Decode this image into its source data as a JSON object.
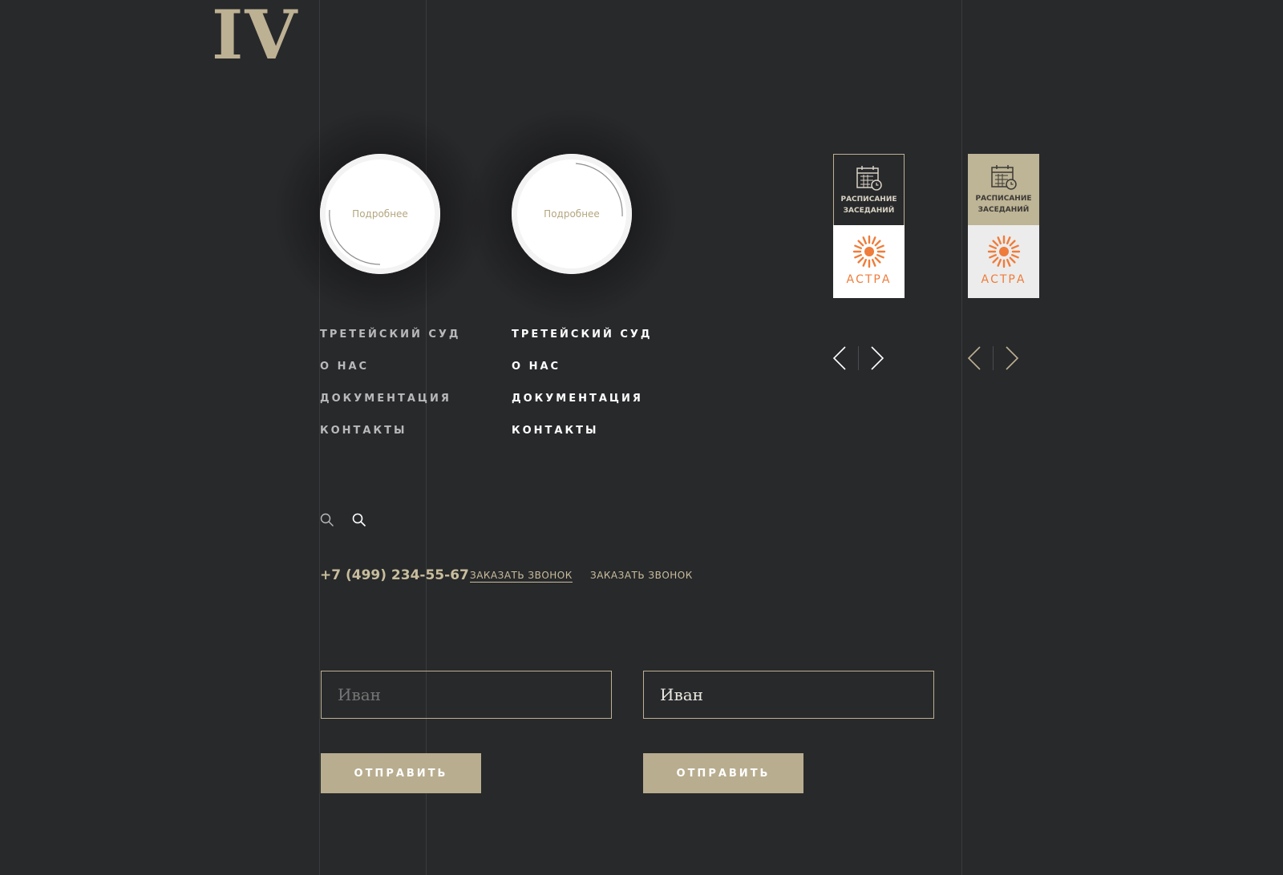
{
  "logo": {
    "text": "IV"
  },
  "circles": [
    {
      "label": "Подробнее"
    },
    {
      "label": "Подробнее"
    }
  ],
  "menu_dim": {
    "items": [
      "ТРЕТЕЙСКИЙ СУД",
      "О НАС",
      "ДОКУМЕНТАЦИЯ",
      "КОНТАКТЫ"
    ]
  },
  "menu_bright": {
    "items": [
      "ТРЕТЕЙСКИЙ СУД",
      "О НАС",
      "ДОКУМЕНТАЦИЯ",
      "КОНТАКТЫ"
    ]
  },
  "widgets": [
    {
      "line1": "РАСПИСАНИЕ",
      "line2": "ЗАСЕДАНИЙ",
      "brand": "АСТРА",
      "icon": "calendar-clock-icon",
      "logo_icon": "sun-logo-icon"
    },
    {
      "line1": "РАСПИСАНИЕ",
      "line2": "ЗАСЕДАНИЙ",
      "brand": "АСТРА",
      "icon": "calendar-clock-icon",
      "logo_icon": "sun-logo-icon"
    }
  ],
  "contact": {
    "phone": "+7 (499) 234-55-67",
    "callback_1": "ЗАКАЗАТЬ ЗВОНОК",
    "callback_2": "ЗАКАЗАТЬ ЗВОНОК"
  },
  "form": {
    "field_1_placeholder": "Иван",
    "field_2_value": "Иван",
    "submit_1": "ОТПРАВИТЬ",
    "submit_2": "ОТПРАВИТЬ"
  },
  "colors": {
    "background": "#28292b",
    "gold": "#bdb193",
    "button": "#b8ad8f",
    "brand_orange": "#ef7c3a"
  }
}
